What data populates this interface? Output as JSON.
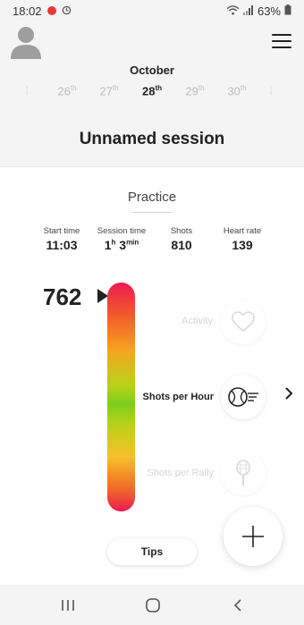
{
  "status_bar": {
    "time": "18:02",
    "battery": "63%",
    "icons": [
      "record-dot-icon",
      "sync-icon",
      "wifi-icon",
      "signal-icon",
      "battery-icon"
    ]
  },
  "header": {
    "month": "October",
    "dates": [
      {
        "day": "26",
        "suffix": "th",
        "selected": false
      },
      {
        "day": "27",
        "suffix": "th",
        "selected": false
      },
      {
        "day": "28",
        "suffix": "th",
        "selected": true
      },
      {
        "day": "29",
        "suffix": "th",
        "selected": false
      },
      {
        "day": "30",
        "suffix": "th",
        "selected": false
      }
    ],
    "session_title": "Unnamed session"
  },
  "session": {
    "type": "Practice",
    "stats": {
      "start_time": {
        "label": "Start time",
        "value": "11:03"
      },
      "session_time": {
        "label": "Session time",
        "hours": "1",
        "hours_unit": "h",
        "minutes": "3",
        "minutes_unit": "min"
      },
      "shots": {
        "label": "Shots",
        "value": "810"
      },
      "heart_rate": {
        "label": "Heart rate",
        "value": "139"
      }
    },
    "current_value": "762",
    "metrics": [
      {
        "label": "Activity",
        "icon": "heart-icon",
        "active": false
      },
      {
        "label": "Shots per Hour",
        "icon": "fast-ball-icon",
        "active": true
      },
      {
        "label": "Shots per Rally",
        "icon": "racket-icon",
        "active": false
      }
    ],
    "tips_label": "Tips"
  },
  "colors": {
    "gauge_top": "#ed1b52",
    "gauge_mid": "#7dce1b",
    "gauge_bottom": "#ed1b52",
    "record_dot": "#e53935"
  },
  "nav": [
    "recents-icon",
    "home-icon",
    "back-icon"
  ]
}
